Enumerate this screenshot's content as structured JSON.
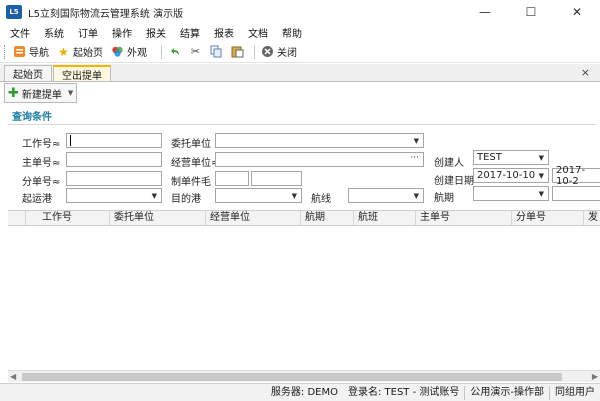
{
  "window": {
    "logo": "L5",
    "title": "L5立刻国际物流云管理系统 演示版",
    "minimize": "—",
    "maximize": "☐",
    "close": "✕"
  },
  "menu": [
    "文件",
    "系统",
    "订单",
    "操作",
    "报关",
    "结算",
    "报表",
    "文档",
    "帮助"
  ],
  "toolbar": {
    "nav": "导航",
    "home": "起始页",
    "appearance": "外观",
    "close": "关闭"
  },
  "tabs": [
    "起始页",
    "空出提单"
  ],
  "tab_close": "×",
  "new_bill_button": "新建提单",
  "section_title": "查询条件",
  "form": {
    "work_no": "工作号≈",
    "client": "委托单位",
    "master_no": "主单号≈",
    "operator_unit": "经营单位≈",
    "creator": "创建人",
    "creator_value": "TEST",
    "sub_no": "分单号≈",
    "pieces_weight": "制单件毛",
    "create_date": "创建日期",
    "date_from": "2017-10-10",
    "date_to": "2017-10-2",
    "origin_port": "起运港",
    "dest_port": "目的港",
    "route": "航线",
    "flight_period": "航期",
    "ellipsis": "···"
  },
  "grid_columns": [
    "工作号",
    "委托单位",
    "经营单位",
    "航期",
    "航班",
    "主单号",
    "分单号",
    "发"
  ],
  "status": {
    "server_label": "服务器:",
    "server_value": "DEMO",
    "login_label": "登录名:",
    "login_value": "TEST - 测试账号",
    "company": "公用演示-操作部",
    "users": "同组用户"
  },
  "colors": {
    "accent": "#1c7fa6",
    "tab_active_border": "#f4b400",
    "logo_bg": "#1d5fa8"
  }
}
